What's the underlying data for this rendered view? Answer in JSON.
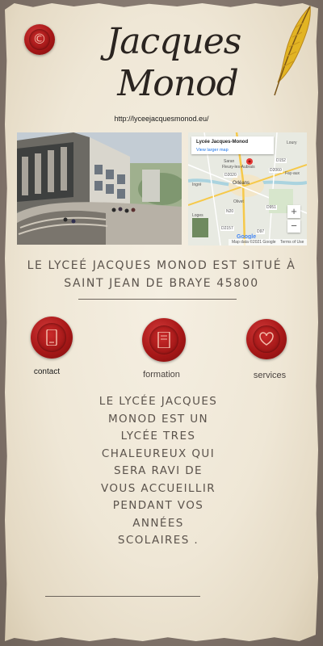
{
  "site": {
    "title_line1": "Jacques",
    "title_line2": "Monod",
    "url": "http://lyceejacquesmonod.eu/",
    "logo_icon": "copyright-seal-icon",
    "quill_icon": "feather-quill-icon"
  },
  "map": {
    "place_name": "Lycée Jacques-Monod",
    "larger_map_link": "View larger map",
    "zoom_in": "+",
    "zoom_out": "−",
    "attribution": "Map data ©2021 Google",
    "terms": "Terms of Use",
    "provider": "Google",
    "towns": [
      "Loury",
      "Saran",
      "Fleury-les-Aubrais",
      "Orléans",
      "Olivet",
      "Ingré",
      "Fay-aux",
      "Loges"
    ],
    "road_labels": [
      "D152",
      "D2060",
      "D2020",
      "N20",
      "D951",
      "D2157",
      "D97"
    ]
  },
  "location_text": "LE LYCEÉ JACQUES MONOD EST SITUÉ À SAINT JEAN DE BRAYE 45800",
  "nav": [
    {
      "label": "contact",
      "icon": "phone-icon"
    },
    {
      "label": "formation",
      "icon": "book-icon"
    },
    {
      "label": "services",
      "icon": "heart-icon"
    }
  ],
  "description": "LE LYCÉE JACQUES\nMONOD EST UN\nLYCÉE TRES\nCHALEUREUX QUI\nSERA RAVI DE\nVOUS ACCUEILLIR\nPENDANT VOS\nANNÉES\nSCOLAIRES .",
  "colors": {
    "seal_red": "#a81818",
    "paper": "#efe7d6",
    "text": "#5b534c",
    "quill_gold": "#e2b423"
  }
}
